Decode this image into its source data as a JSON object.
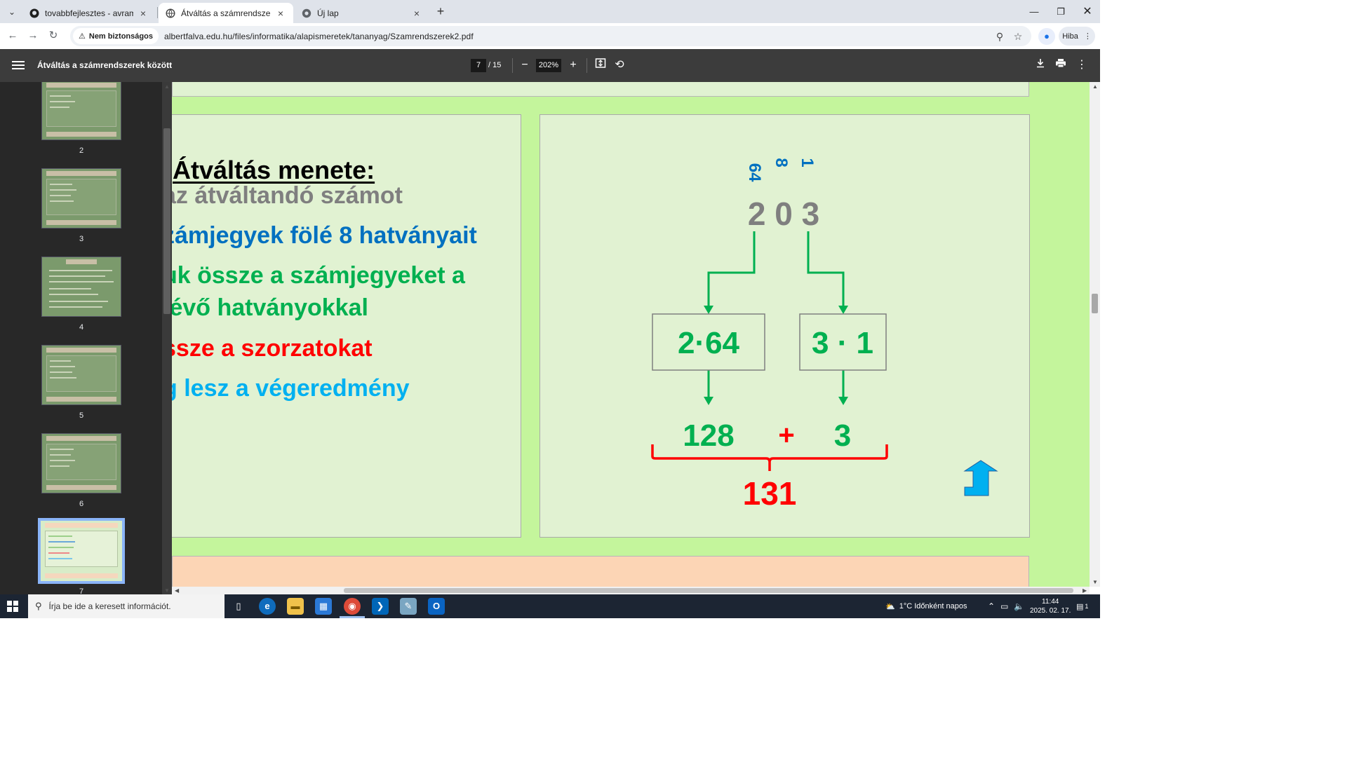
{
  "browser": {
    "tabs": [
      {
        "label": "tovabbfejlesztes - avramuczpist",
        "icon": "github-icon",
        "active": false
      },
      {
        "label": "Átváltás a számrendszerek közö",
        "icon": "globe-icon",
        "active": true
      },
      {
        "label": "Új lap",
        "icon": "chrome-icon",
        "active": false
      }
    ],
    "new_tab": "+",
    "security_label": "Nem biztonságos",
    "url": "albertfalva.edu.hu/files/informatika/alapismeretek/tananyag/Szamrendszerek2.pdf",
    "profile_error_label": "Hiba"
  },
  "pdf_toolbar": {
    "title": "Átváltás a számrendszerek között",
    "current_page": "7",
    "total_pages": "/ 15",
    "zoom": "202%"
  },
  "thumbnails": [
    {
      "number": "2",
      "selected": false
    },
    {
      "number": "3",
      "selected": false
    },
    {
      "number": "4",
      "selected": false
    },
    {
      "number": "5",
      "selected": false
    },
    {
      "number": "6",
      "selected": false
    },
    {
      "number": "7",
      "selected": true
    }
  ],
  "slide": {
    "heading": "Átváltás menete:",
    "steps": [
      {
        "text": "az átváltandó számot",
        "color": "#7f7f7f"
      },
      {
        "text": "zámjegyek fölé 8 hatványait",
        "color": "#0070c0"
      },
      {
        "text": "uk össze a számjegyeket a",
        "color": "#00b050"
      },
      {
        "text": " lévő hatványokkal",
        "color": "#00b050"
      },
      {
        "text": "ssze a szorzatokat",
        "color": "#ff0000"
      },
      {
        "text": "g lesz a végeredmény",
        "color": "#00b0f0"
      }
    ],
    "powers": [
      "64",
      "8",
      "1"
    ],
    "number_digits": "2 0 3",
    "products": [
      "2·64",
      "3 · 1"
    ],
    "partial_results": [
      "128",
      "3"
    ],
    "plus": "+",
    "total": "131",
    "colors": {
      "gray": "#7f7f7f",
      "blue": "#0070c0",
      "green": "#00b050",
      "red": "#ff0000",
      "cyan": "#00b0f0"
    }
  },
  "taskbar": {
    "search_placeholder": "Írja be ide a keresett információt.",
    "weather": "1°C  Időnként napos",
    "time": "11:44",
    "date": "2025. 02. 17.",
    "notification_count": "1"
  }
}
